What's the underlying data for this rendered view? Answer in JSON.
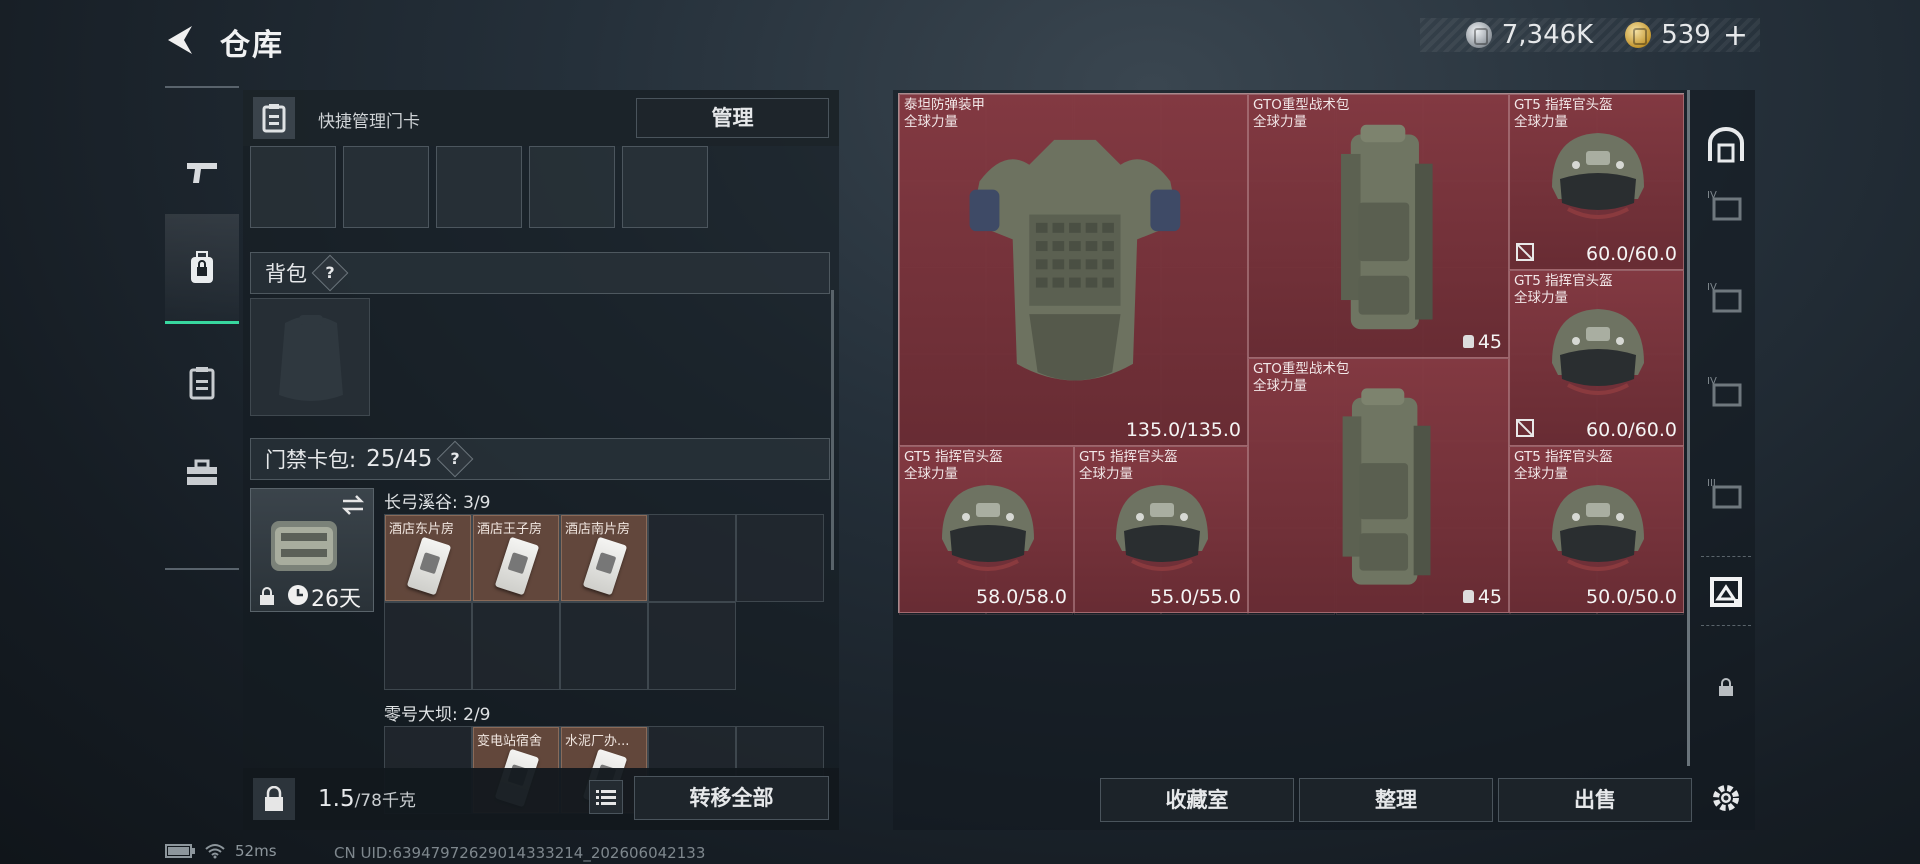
{
  "header": {
    "title": "仓库",
    "currency_silver": "7,346K",
    "currency_gold": "539",
    "plus": "+"
  },
  "left_panel": {
    "card_header_label": "快捷管理门卡",
    "manage_label": "管理",
    "backpack_label": "背包",
    "help_symbol": "?",
    "keypack_label": "门禁卡包:",
    "keypack_count": "25/45",
    "keypack_days": "26天",
    "areas": [
      {
        "name": "长弓溪谷: 3/9",
        "cards": [
          "酒店东片房",
          "酒店王子房",
          "酒店南片房"
        ]
      },
      {
        "name": "零号大坝: 2/9",
        "cards": [
          "变电站宿舍",
          "水泥厂办..."
        ]
      }
    ]
  },
  "bottom_left": {
    "weight": "1.5",
    "weight_max": "/78千克",
    "transfer_label": "转移全部"
  },
  "stash": {
    "items": [
      {
        "name": "泰坦防弹装甲",
        "sub": "全球力量",
        "value": "135.0/135.0",
        "art": "armor"
      },
      {
        "name": "GTO重型战术包",
        "sub": "全球力量",
        "value": "45",
        "art": "pack"
      },
      {
        "name": "GT5 指挥官头盔",
        "sub": "全球力量",
        "value": "60.0/60.0",
        "art": "helmet"
      },
      {
        "name": "GT5 指挥官头盔",
        "sub": "全球力量",
        "value": "60.0/60.0",
        "art": "helmet"
      },
      {
        "name": "GTO重型战术包",
        "sub": "全球力量",
        "value": "45",
        "art": "pack"
      },
      {
        "name": "GT5 指挥官头盔",
        "sub": "全球力量",
        "value": "58.0/58.0",
        "art": "helmet"
      },
      {
        "name": "GT5 指挥官头盔",
        "sub": "全球力量",
        "value": "55.0/55.0",
        "art": "helmet"
      },
      {
        "name": "GT5 指挥官头盔",
        "sub": "全球力量",
        "value": "50.0/50.0",
        "art": "helmet"
      }
    ]
  },
  "bottom_right": {
    "collection_label": "收藏室",
    "sort_label": "整理",
    "sell_label": "出售"
  },
  "status": {
    "ping": "52ms",
    "uid": "CN UID:639479726290143332​14_202606042133"
  },
  "colors": {
    "accent_green": "#38d79f",
    "item_bg": "#7e3a42",
    "panel_bg": "#141b21"
  }
}
